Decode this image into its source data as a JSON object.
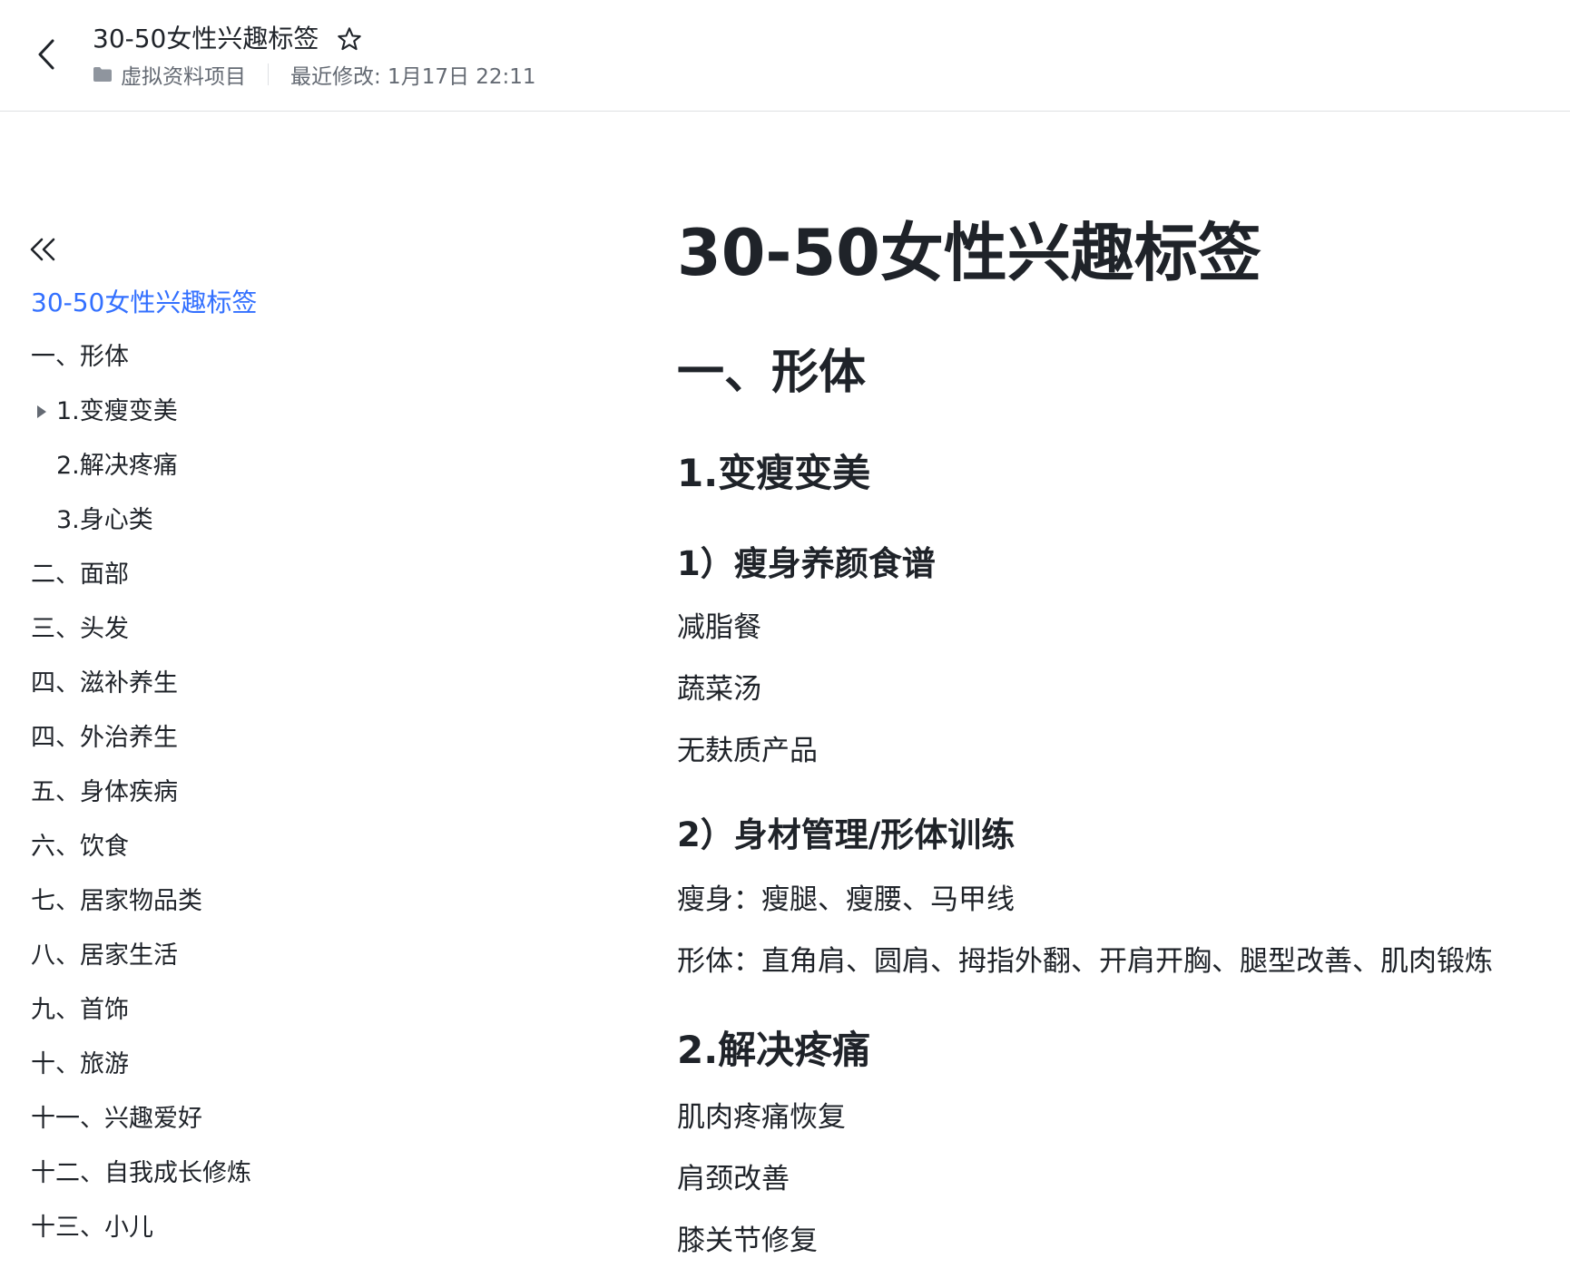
{
  "header": {
    "title": "30-50女性兴趣标签",
    "folder": "虚拟资料项目",
    "last_modified": "最近修改: 1月17日 22:11"
  },
  "toc": {
    "doc_title": "30-50女性兴趣标签",
    "items": [
      "一、形体",
      "1.变瘦变美",
      "2.解决疼痛",
      "3.身心类",
      "二、面部",
      "三、头发",
      "四、滋补养生",
      "四、外治养生",
      "五、身体疾病",
      "六、饮食",
      "七、居家物品类",
      "八、居家生活",
      "九、首饰",
      "十、旅游",
      "十一、兴趣爱好",
      "十二、自我成长修炼",
      "十三、小儿"
    ]
  },
  "content": {
    "title": "30-50女性兴趣标签",
    "section1": "一、形体",
    "sub1": "1.变瘦变美",
    "sub1_1": "1）瘦身养颜食谱",
    "sub1_1_items": [
      "减脂餐",
      "蔬菜汤",
      "无麸质产品"
    ],
    "sub1_2": "2）身材管理/形体训练",
    "sub1_2_items": [
      "瘦身：瘦腿、瘦腰、马甲线",
      "形体：直角肩、圆肩、拇指外翻、开肩开胸、腿型改善、肌肉锻炼"
    ],
    "sub2": "2.解决疼痛",
    "sub2_items": [
      "肌肉疼痛恢复",
      "肩颈改善",
      "膝关节修复"
    ]
  },
  "colors": {
    "accent": "#3370ff",
    "text": "#1f2329",
    "secondary": "#646a73",
    "divider": "#dee0e3"
  }
}
